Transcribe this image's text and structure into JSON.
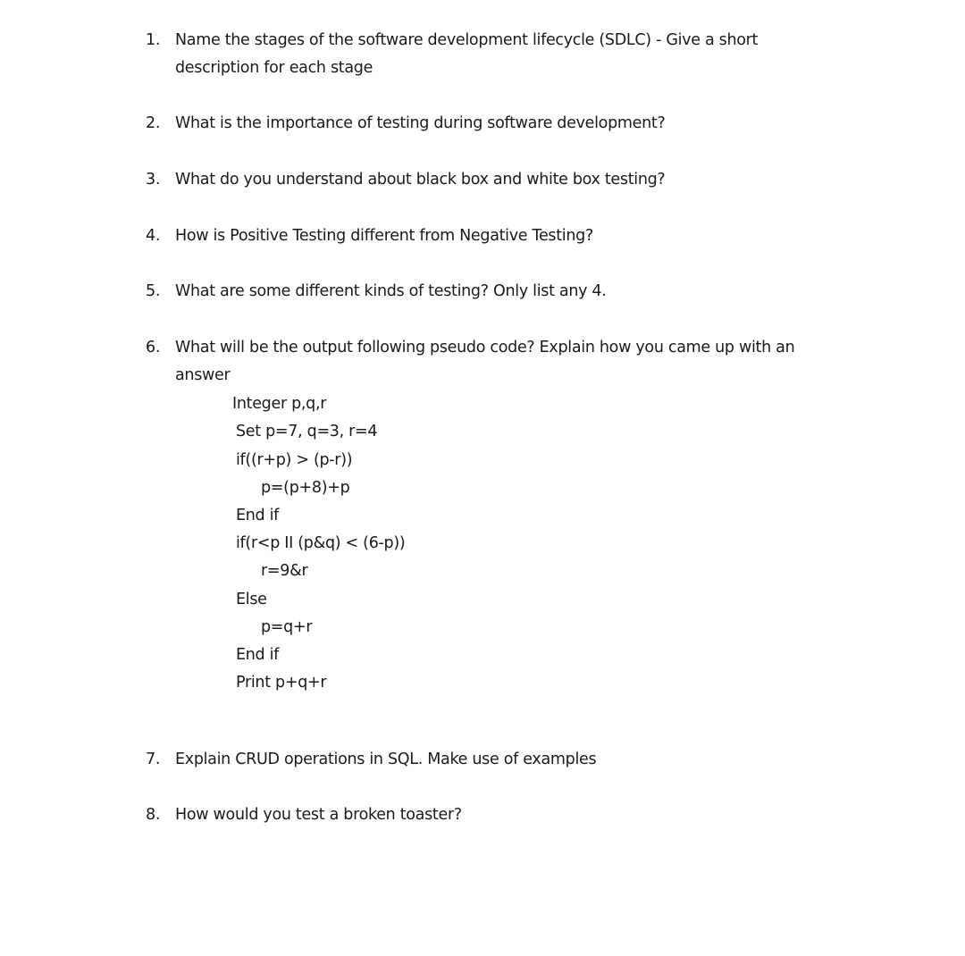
{
  "questions": [
    {
      "number": "1.",
      "lines": [
        "Name the stages of the software development lifecycle (SDLC) - Give a short",
        "description for each stage"
      ]
    },
    {
      "number": "2.",
      "lines": [
        "What is the importance of testing during software development?"
      ]
    },
    {
      "number": "3.",
      "lines": [
        "What do you understand about black box and white box testing?"
      ]
    },
    {
      "number": "4.",
      "lines": [
        "How is Positive Testing different from Negative Testing?"
      ]
    },
    {
      "number": "5.",
      "lines": [
        "What are some different kinds of testing? Only list any 4."
      ]
    },
    {
      "number": "6.",
      "lines": [
        "What will be the output following pseudo code? Explain how you came up with an",
        "answer"
      ]
    },
    {
      "number": "7.",
      "lines": [
        "Explain CRUD operations in SQL. Make use of examples"
      ]
    },
    {
      "number": "8.",
      "lines": [
        "How would you test a broken toaster?"
      ]
    }
  ],
  "pseudo_code": [
    "Integer p,q,r",
    "Set p=7, q=3, r=4",
    "if((r+p) > (p-r))",
    "p=(p+8)+p",
    "End if",
    "if(r<p II (p&q) < (6-p))",
    "r=9&r",
    "Else",
    "p=q+r",
    "End if",
    "Print p+q+r"
  ]
}
